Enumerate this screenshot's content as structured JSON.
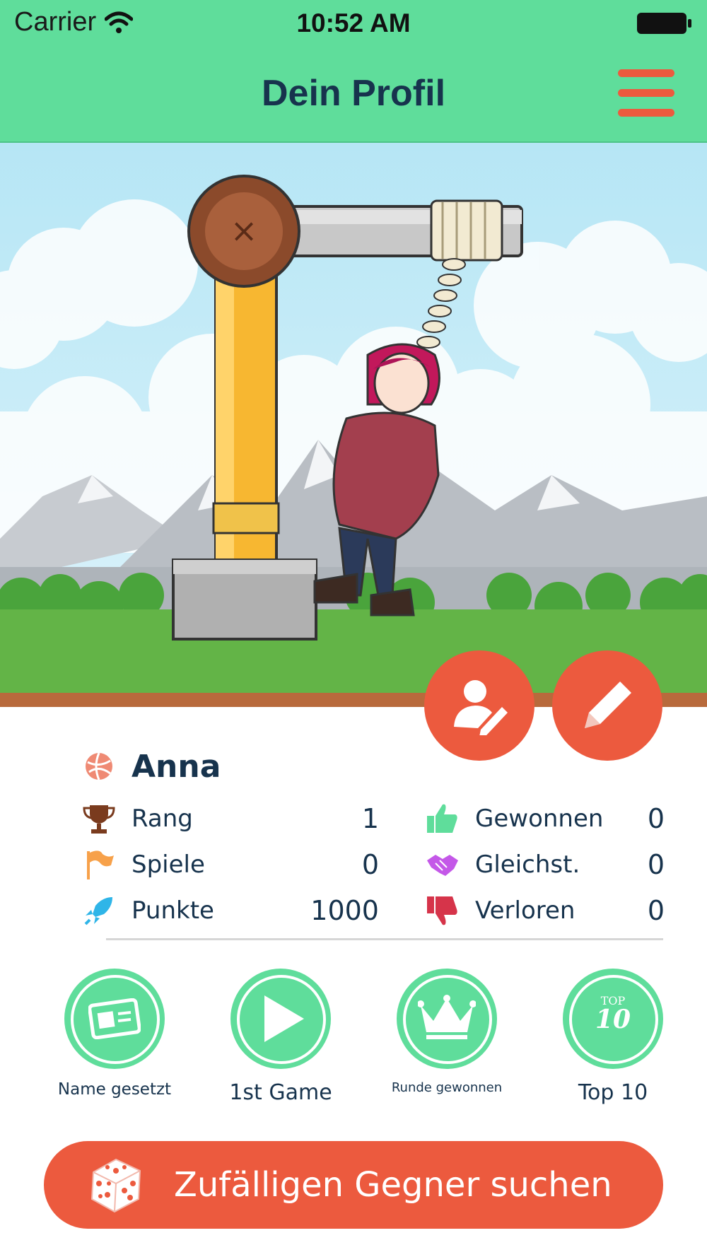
{
  "status_bar": {
    "carrier": "Carrier",
    "time": "10:52 AM"
  },
  "header": {
    "title": "Dein Profil"
  },
  "profile": {
    "name": "Anna",
    "stats_left": [
      {
        "label": "Rang",
        "value": "1",
        "icon": "trophy-icon"
      },
      {
        "label": "Spiele",
        "value": "0",
        "icon": "flag-icon"
      },
      {
        "label": "Punkte",
        "value": "1000",
        "icon": "rocket-icon"
      }
    ],
    "stats_right": [
      {
        "label": "Gewonnen",
        "value": "0",
        "icon": "thumbs-up-icon"
      },
      {
        "label": "Gleichst.",
        "value": "0",
        "icon": "handshake-icon"
      },
      {
        "label": "Verloren",
        "value": "0",
        "icon": "thumbs-down-icon"
      }
    ]
  },
  "achievements": [
    {
      "label": "Name gesetzt",
      "icon": "id-card-icon"
    },
    {
      "label": "1st Game",
      "icon": "play-icon"
    },
    {
      "label": "Runde gewonnen",
      "icon": "crown-icon"
    },
    {
      "label": "Top 10",
      "icon": "top10-icon",
      "badge_top": "TOP",
      "badge_num": "10"
    }
  ],
  "cta": {
    "label": "Zufälligen Gegner suchen",
    "icon": "dice-icon"
  },
  "colors": {
    "header_green": "#5fdd9b",
    "accent_red": "#ec5a3e",
    "text_navy": "#17334d"
  }
}
